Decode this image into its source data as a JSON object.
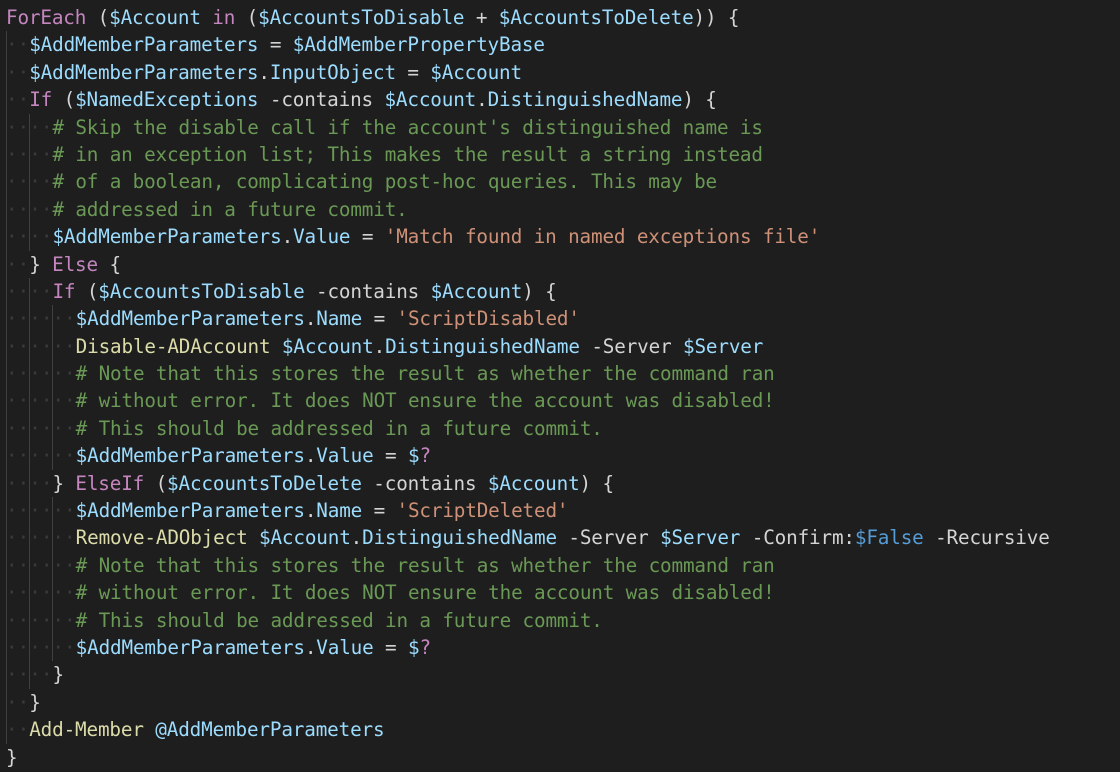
{
  "editor": {
    "language": "PowerShell",
    "theme_colors": {
      "background": "#1e1e1e",
      "default": "#d4d4d4",
      "keyword": "#c586c0",
      "variable": "#9cdcfe",
      "string": "#ce9178",
      "comment": "#6a9955",
      "function": "#dcdcaa",
      "constant": "#569cd6",
      "whitespace_marker": "#3b3b3b"
    },
    "lines": [
      {
        "indent": 0,
        "tokens": [
          [
            "kw",
            "ForEach"
          ],
          [
            "op",
            " ("
          ],
          [
            "var",
            "$Account"
          ],
          [
            "op",
            " "
          ],
          [
            "kw",
            "in"
          ],
          [
            "op",
            " ("
          ],
          [
            "var",
            "$AccountsToDisable"
          ],
          [
            "op",
            " + "
          ],
          [
            "var",
            "$AccountsToDelete"
          ],
          [
            "op",
            ")) {"
          ]
        ]
      },
      {
        "indent": 1,
        "tokens": [
          [
            "var",
            "$AddMemberParameters"
          ],
          [
            "op",
            " = "
          ],
          [
            "var",
            "$AddMemberPropertyBase"
          ]
        ]
      },
      {
        "indent": 1,
        "tokens": [
          [
            "var",
            "$AddMemberParameters"
          ],
          [
            "op",
            "."
          ],
          [
            "prop",
            "InputObject"
          ],
          [
            "op",
            " = "
          ],
          [
            "var",
            "$Account"
          ]
        ]
      },
      {
        "indent": 1,
        "tokens": [
          [
            "kw",
            "If"
          ],
          [
            "op",
            " ("
          ],
          [
            "var",
            "$NamedExceptions"
          ],
          [
            "op",
            " -contains "
          ],
          [
            "var",
            "$Account"
          ],
          [
            "op",
            "."
          ],
          [
            "prop",
            "DistinguishedName"
          ],
          [
            "op",
            ") {"
          ]
        ]
      },
      {
        "indent": 2,
        "tokens": [
          [
            "com",
            "# Skip the disable call if the account's distinguished name is"
          ]
        ]
      },
      {
        "indent": 2,
        "tokens": [
          [
            "com",
            "# in an exception list; This makes the result a string instead"
          ]
        ]
      },
      {
        "indent": 2,
        "tokens": [
          [
            "com",
            "# of a boolean, complicating post-hoc queries. This may be"
          ]
        ]
      },
      {
        "indent": 2,
        "tokens": [
          [
            "com",
            "# addressed in a future commit."
          ]
        ]
      },
      {
        "indent": 2,
        "tokens": [
          [
            "var",
            "$AddMemberParameters"
          ],
          [
            "op",
            "."
          ],
          [
            "prop",
            "Value"
          ],
          [
            "op",
            " = "
          ],
          [
            "str",
            "'Match found in named exceptions file'"
          ]
        ]
      },
      {
        "indent": 1,
        "tokens": [
          [
            "op",
            "} "
          ],
          [
            "kw",
            "Else"
          ],
          [
            "op",
            " {"
          ]
        ]
      },
      {
        "indent": 2,
        "tokens": [
          [
            "kw",
            "If"
          ],
          [
            "op",
            " ("
          ],
          [
            "var",
            "$AccountsToDisable"
          ],
          [
            "op",
            " -contains "
          ],
          [
            "var",
            "$Account"
          ],
          [
            "op",
            ") {"
          ]
        ]
      },
      {
        "indent": 3,
        "tokens": [
          [
            "var",
            "$AddMemberParameters"
          ],
          [
            "op",
            "."
          ],
          [
            "prop",
            "Name"
          ],
          [
            "op",
            " = "
          ],
          [
            "str",
            "'ScriptDisabled'"
          ]
        ]
      },
      {
        "indent": 3,
        "tokens": [
          [
            "fn",
            "Disable-ADAccount"
          ],
          [
            "op",
            " "
          ],
          [
            "var",
            "$Account"
          ],
          [
            "op",
            "."
          ],
          [
            "prop",
            "DistinguishedName"
          ],
          [
            "op",
            " -Server "
          ],
          [
            "var",
            "$Server"
          ]
        ]
      },
      {
        "indent": 3,
        "tokens": [
          [
            "com",
            "# Note that this stores the result as whether the command ran"
          ]
        ]
      },
      {
        "indent": 3,
        "tokens": [
          [
            "com",
            "# without error. It does NOT ensure the account was disabled!"
          ]
        ]
      },
      {
        "indent": 3,
        "tokens": [
          [
            "com",
            "# This should be addressed in a future commit."
          ]
        ]
      },
      {
        "indent": 3,
        "tokens": [
          [
            "var",
            "$AddMemberParameters"
          ],
          [
            "op",
            "."
          ],
          [
            "prop",
            "Value"
          ],
          [
            "op",
            " = "
          ],
          [
            "var",
            "$"
          ],
          [
            "kw",
            "?"
          ]
        ]
      },
      {
        "indent": 2,
        "tokens": [
          [
            "op",
            "} "
          ],
          [
            "kw",
            "ElseIf"
          ],
          [
            "op",
            " ("
          ],
          [
            "var",
            "$AccountsToDelete"
          ],
          [
            "op",
            " -contains "
          ],
          [
            "var",
            "$Account"
          ],
          [
            "op",
            ") {"
          ]
        ]
      },
      {
        "indent": 3,
        "tokens": [
          [
            "var",
            "$AddMemberParameters"
          ],
          [
            "op",
            "."
          ],
          [
            "prop",
            "Name"
          ],
          [
            "op",
            " = "
          ],
          [
            "str",
            "'ScriptDeleted'"
          ]
        ]
      },
      {
        "indent": 3,
        "tokens": [
          [
            "fn",
            "Remove-ADObject"
          ],
          [
            "op",
            " "
          ],
          [
            "var",
            "$Account"
          ],
          [
            "op",
            "."
          ],
          [
            "prop",
            "DistinguishedName"
          ],
          [
            "op",
            " -Server "
          ],
          [
            "var",
            "$Server"
          ],
          [
            "op",
            " -Confirm:"
          ],
          [
            "bool",
            "$False"
          ],
          [
            "op",
            " -Recursive"
          ]
        ]
      },
      {
        "indent": 3,
        "tokens": [
          [
            "com",
            "# Note that this stores the result as whether the command ran"
          ]
        ]
      },
      {
        "indent": 3,
        "tokens": [
          [
            "com",
            "# without error. It does NOT ensure the account was disabled!"
          ]
        ]
      },
      {
        "indent": 3,
        "tokens": [
          [
            "com",
            "# This should be addressed in a future commit."
          ]
        ]
      },
      {
        "indent": 3,
        "tokens": [
          [
            "var",
            "$AddMemberParameters"
          ],
          [
            "op",
            "."
          ],
          [
            "prop",
            "Value"
          ],
          [
            "op",
            " = "
          ],
          [
            "var",
            "$"
          ],
          [
            "kw",
            "?"
          ]
        ]
      },
      {
        "indent": 2,
        "tokens": [
          [
            "op",
            "}"
          ]
        ]
      },
      {
        "indent": 1,
        "tokens": [
          [
            "op",
            "}"
          ]
        ]
      },
      {
        "indent": 1,
        "tokens": [
          [
            "fn",
            "Add-Member"
          ],
          [
            "op",
            " "
          ],
          [
            "var",
            "@AddMemberParameters"
          ]
        ]
      },
      {
        "indent": 0,
        "tokens": [
          [
            "op",
            "}"
          ]
        ]
      }
    ]
  }
}
